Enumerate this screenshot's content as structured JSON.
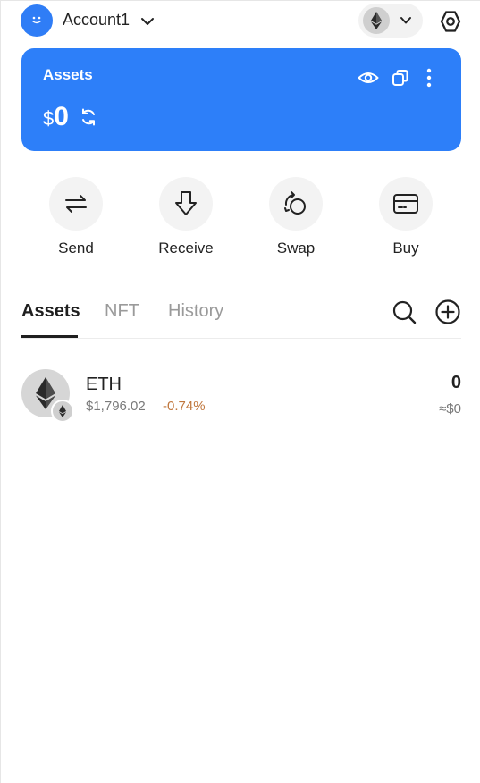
{
  "header": {
    "account_name": "Account1"
  },
  "card": {
    "title": "Assets",
    "currency_symbol": "$",
    "balance": "0"
  },
  "actions": [
    {
      "label": "Send"
    },
    {
      "label": "Receive"
    },
    {
      "label": "Swap"
    },
    {
      "label": "Buy"
    }
  ],
  "tabs": [
    {
      "label": "Assets",
      "active": true
    },
    {
      "label": "NFT",
      "active": false
    },
    {
      "label": "History",
      "active": false
    }
  ],
  "assets": [
    {
      "symbol": "ETH",
      "price": "$1,796.02",
      "change": "-0.74%",
      "amount": "0",
      "value": "≈$0"
    }
  ],
  "colors": {
    "accent": "#2d7ff9",
    "negative_change": "#c0773d"
  }
}
